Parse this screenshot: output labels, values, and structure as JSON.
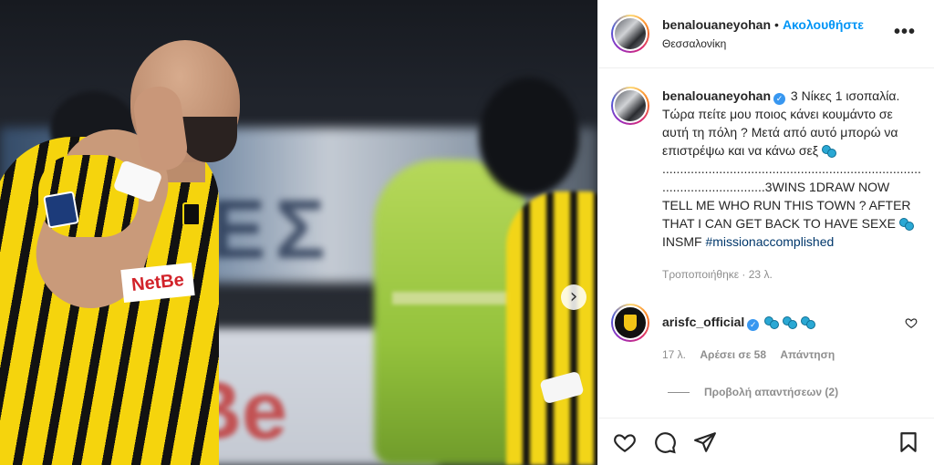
{
  "header": {
    "username": "benalouaneyohan",
    "follow_label": "Ακολουθήστε",
    "location": "Θεσσαλονίκη",
    "more_label": "•••"
  },
  "photo": {
    "sponsor_text": "NetBe",
    "banner_text": "ΕΣ",
    "lower_text": "Be",
    "next_arrow": "›"
  },
  "caption": {
    "username": "benalouaneyohan",
    "text_greek": "3 Νίκες 1 ισοπαλία. Τώρα πείτε μου ποιος κάνει κουμάντο σε αυτή τη πόλη ? Μετά από αυτό μπορώ να επιστρέψω και να κάνω σεξ",
    "dots": "......................................................................................................3WINS 1DRAW NOW TELL ME WHO RUN THIS TOWN ? AFTER THAT I CAN GET BACK TO HAVE SEXE",
    "signature": "INSMF",
    "hashtag": "#missionaccomplished",
    "edited": "Τροποποιήθηκε · 23 λ."
  },
  "comment": {
    "username": "arisfc_official",
    "time": "17 λ.",
    "likes": "Αρέσει σε 58",
    "reply": "Απάντηση",
    "view_replies": "Προβολή απαντήσεων (2)"
  },
  "icons": {
    "like": "heart-icon",
    "comment": "comment-icon",
    "share": "share-icon",
    "save": "bookmark-icon"
  },
  "colors": {
    "accent": "#0095f6",
    "verified": "#3897f0",
    "hashtag": "#00376b",
    "muted": "#8e8e8e"
  }
}
